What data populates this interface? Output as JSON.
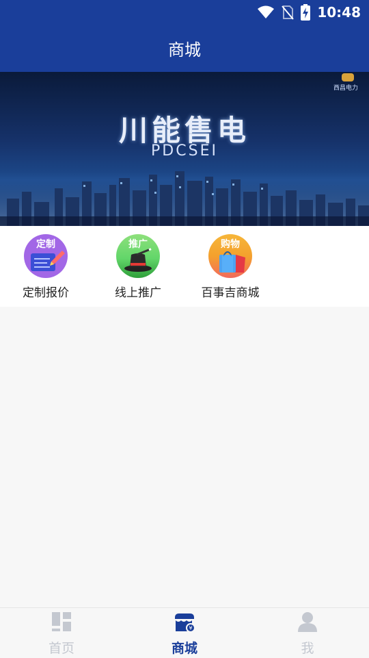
{
  "status_bar": {
    "time": "10:48"
  },
  "header": {
    "title": "商城"
  },
  "banner": {
    "title": "川能售电",
    "subtitle": "PDCSEI",
    "logo_text": "西昌电力"
  },
  "services": [
    {
      "icon_label": "定制",
      "label": "定制报价",
      "icon": "custom-quote-icon",
      "color": "#a267e6"
    },
    {
      "icon_label": "推广",
      "label": "线上推广",
      "icon": "magic-hat-icon",
      "color": "#63d66a"
    },
    {
      "icon_label": "购物",
      "label": "百事吉商城",
      "icon": "shopping-bag-icon",
      "color": "#f26a5d"
    }
  ],
  "tabbar": {
    "items": [
      {
        "label": "首页",
        "icon": "dashboard-icon",
        "active": false
      },
      {
        "label": "商城",
        "icon": "store-icon",
        "active": true
      },
      {
        "label": "我",
        "icon": "user-icon",
        "active": false
      }
    ]
  },
  "colors": {
    "primary": "#1a3e9a",
    "background": "#f7f7f7",
    "inactive_tab": "#c4c8d0"
  }
}
